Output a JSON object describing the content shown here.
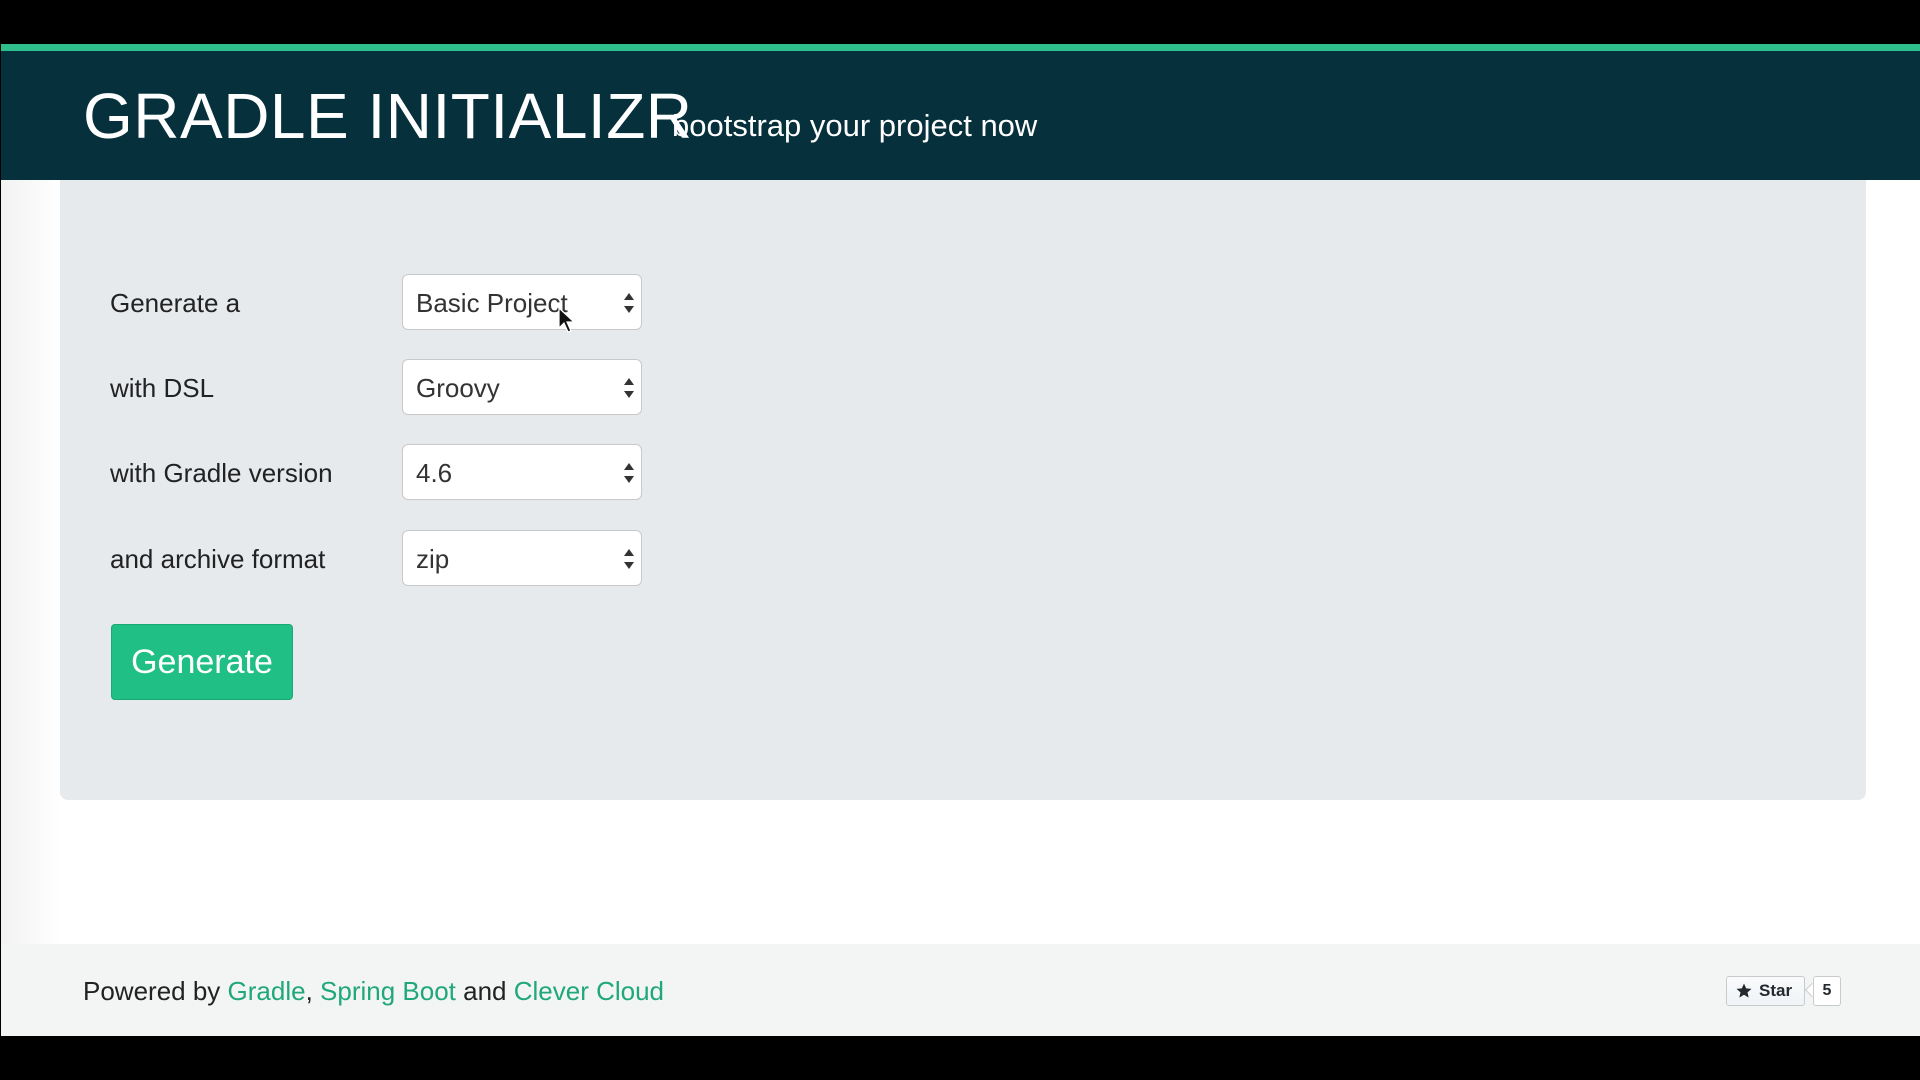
{
  "header": {
    "brand": "GRADLE INITIALIZR",
    "tagline": "bootstrap your project now"
  },
  "form": {
    "rows": [
      {
        "label": "Generate a",
        "value": "Basic Project"
      },
      {
        "label": "with DSL",
        "value": "Groovy"
      },
      {
        "label": "with Gradle version",
        "value": "4.6"
      },
      {
        "label": "and archive format",
        "value": "zip"
      }
    ],
    "generate_label": "Generate"
  },
  "footer": {
    "prefix": "Powered by ",
    "link_gradle": "Gradle",
    "sep1": ", ",
    "link_spring": "Spring Boot",
    "sep2": " and ",
    "link_clever": "Clever Cloud",
    "star_label": "Star",
    "star_count": "5",
    "star_icon": "star-icon"
  },
  "colors": {
    "accent": "#2fbf8c",
    "header_bg": "#06303b",
    "panel_bg": "#e6eaed",
    "button_bg": "#20bf85",
    "link": "#20a77a"
  }
}
